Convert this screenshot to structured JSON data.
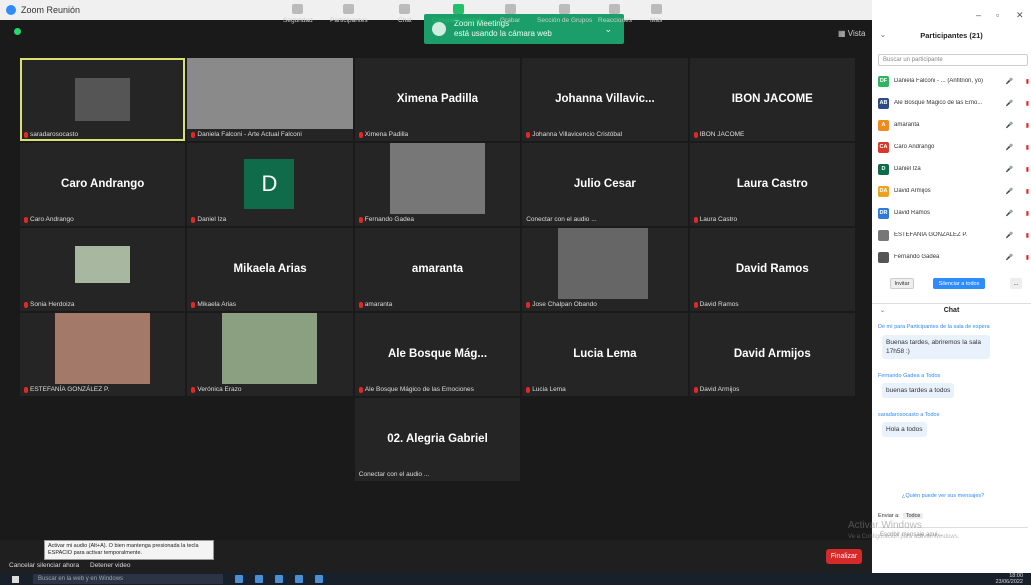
{
  "window": {
    "title": "Zoom Reunión"
  },
  "toast": {
    "line1": "Zoom Meetings",
    "line2": "está usando la cámara web"
  },
  "view_label": "Vista",
  "tiles": [
    {
      "name": "",
      "label": "saradarosocasto",
      "type": "photo"
    },
    {
      "name": "",
      "label": "Daniela Falconi - Arte Actual Falconi",
      "type": "photo"
    },
    {
      "name": "Ximena Padilla",
      "label": "Ximena Padilla",
      "type": "name"
    },
    {
      "name": "Johanna  Villavic...",
      "label": "Johanna Villavicencio Cristóbal",
      "type": "name"
    },
    {
      "name": "IBON JACOME",
      "label": "IBON JACOME",
      "type": "name"
    },
    {
      "name": "Caro Andrango",
      "label": "Caro Andrango",
      "type": "name"
    },
    {
      "name": "",
      "label": "Daniel Iza",
      "type": "avatar",
      "avatar": "D"
    },
    {
      "name": "",
      "label": "Fernando Gadea",
      "type": "photo"
    },
    {
      "name": "Julio Cesar",
      "label": "Conectar con el audio ...",
      "type": "name"
    },
    {
      "name": "Laura Castro",
      "label": "Laura Castro",
      "type": "name"
    },
    {
      "name": "",
      "label": "Sonia Herdoiza",
      "type": "photo"
    },
    {
      "name": "Mikaela Arias",
      "label": "Mikaela Arias",
      "type": "name"
    },
    {
      "name": "amaranta",
      "label": "amaranta",
      "type": "name"
    },
    {
      "name": "",
      "label": "Jose Chalpan Obando",
      "type": "photo"
    },
    {
      "name": "David Ramos",
      "label": "David Ramos",
      "type": "name"
    },
    {
      "name": "",
      "label": "ESTEFANÍA GONZÁLEZ P.",
      "type": "photo"
    },
    {
      "name": "",
      "label": "Verónica Erazo",
      "type": "photo"
    },
    {
      "name": "Ale Bosque Mág...",
      "label": "Ale Bosque Mágico de las Emociones",
      "type": "name"
    },
    {
      "name": "Lucia Lema",
      "label": "Lucia Lema",
      "type": "name"
    },
    {
      "name": "David Armijos",
      "label": "David Armijos",
      "type": "name"
    },
    {
      "name": "",
      "label": "",
      "type": "empty"
    },
    {
      "name": "",
      "label": "",
      "type": "empty"
    },
    {
      "name": "02. Alegria Gabriel",
      "label": "Conectar con el audio ...",
      "type": "name"
    },
    {
      "name": "",
      "label": "",
      "type": "empty"
    },
    {
      "name": "",
      "label": "",
      "type": "empty"
    }
  ],
  "toolbar": {
    "tooltip": "Activar mi audio (Alt+A). O bien mantenga presionada la tecla ESPACIO para activar temporalmente.",
    "cancel": "Cancelar silenciar ahora",
    "stop_video": "Detener video",
    "items": [
      "Seguridad",
      "Participantes",
      "Chat",
      "Compartir pantalla",
      "Grabar",
      "Sección de Grupos",
      "Reacciones",
      "Más"
    ],
    "participants_count": "21",
    "end": "Finalizar"
  },
  "participants": {
    "title": "Participantes (21)",
    "search_placeholder": "Buscar un participante",
    "rows": [
      {
        "initials": "DF",
        "name": "Daniela Falconi - ... (Anfitrión, yo)",
        "color": "#2fb560"
      },
      {
        "initials": "AB",
        "name": "Ale Bosque Mágico de las Emo...",
        "color": "#2a4a8c"
      },
      {
        "initials": "A",
        "name": "amaranta",
        "color": "#f08c1e"
      },
      {
        "initials": "CA",
        "name": "Caro Andrango",
        "color": "#d63a2a"
      },
      {
        "initials": "D",
        "name": "Daniel Iza",
        "color": "#0f6b4a"
      },
      {
        "initials": "DA",
        "name": "David Armijos",
        "color": "#f0a020"
      },
      {
        "initials": "DR",
        "name": "David Ramos",
        "color": "#2d7ad9"
      },
      {
        "initials": "",
        "name": "ESTEFANÍA GONZÁLEZ P.",
        "color": "#777"
      },
      {
        "initials": "",
        "name": "Fernando Gadea",
        "color": "#555"
      }
    ],
    "invite": "Invitar",
    "mute_all": "Silenciar a todos",
    "more": "..."
  },
  "chat": {
    "title": "Chat",
    "messages": [
      {
        "meta": "De mí para Participantes de la sala de espera",
        "text": "Buenas tardes, abriremos la sala 17h58 :)"
      },
      {
        "meta": "Fernando Gadea a Todos",
        "text": "buenas tardes a todos"
      },
      {
        "meta": "saradarosocasto a Todos",
        "text": "Hola a todos"
      }
    ],
    "who_can_see": "¿Quién puede ver sus mensajes?",
    "send_to": "Enviar a:",
    "send_to_value": "Todos",
    "input_placeholder": "Escribir mensaje aquí..."
  },
  "watermark": {
    "line1": "Activar Windows",
    "line2": "Ve a Configuración para activar Windows."
  },
  "taskbar": {
    "search": "Buscar en la web y en Windows",
    "time": "18:00",
    "date": "23/06/2022"
  }
}
